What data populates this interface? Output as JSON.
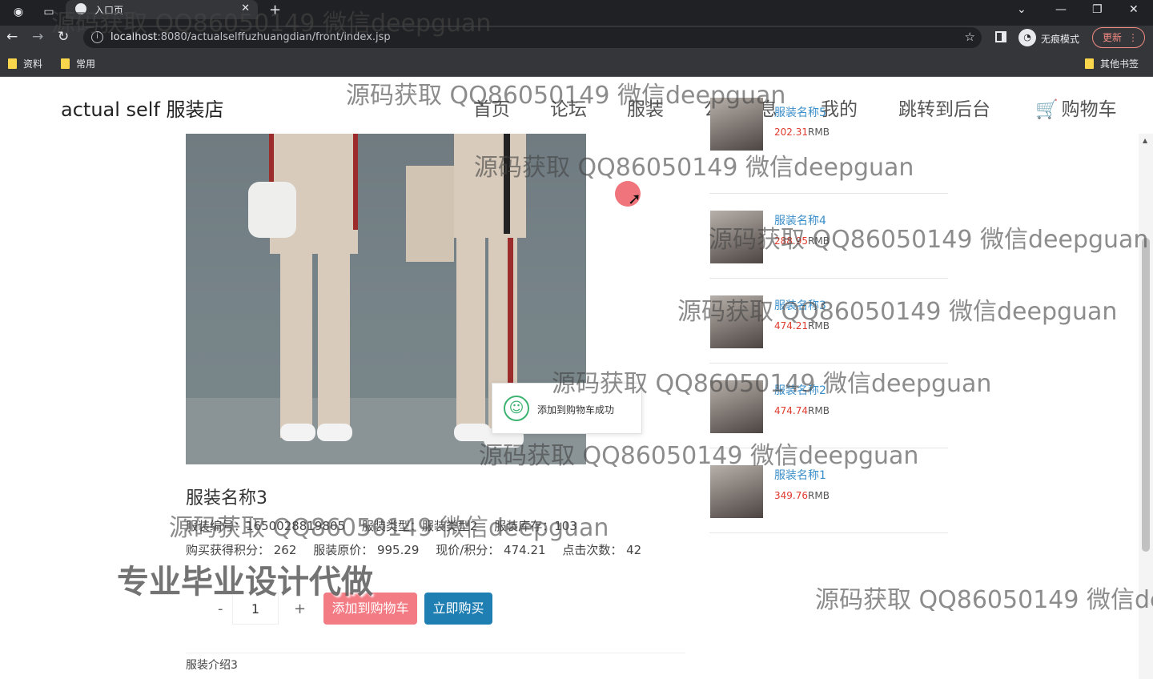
{
  "browser": {
    "tab_title": "入口页",
    "url_host": "localhost",
    "url_rest": ":8080/actualselffuzhuangdian/front/index.jsp",
    "incognito_label": "无痕模式",
    "update_label": "更新",
    "bookmarks": [
      "资料",
      "常用"
    ],
    "other_bookmarks": "其他书签"
  },
  "site": {
    "brand": "actual self 服装店",
    "nav": [
      "首页",
      "论坛",
      "服装",
      "公告信息",
      "我的",
      "跳转到后台",
      "购物车"
    ]
  },
  "product": {
    "name": "服装名称3",
    "meta_row1": [
      "服装编号：1650028819805",
      "服装类型：服装类型2",
      "服装库存：103"
    ],
    "meta_row2": [
      "购买获得积分：  262",
      "服装原价：  995.29",
      "现价/积分：  474.21",
      "点击次数：  42"
    ],
    "quantity": "1",
    "minus": "-",
    "plus": "+",
    "add_to_cart": "添加到购物车",
    "buy_now": "立即购买",
    "intro": "服装介绍3"
  },
  "sidebar": {
    "items": [
      {
        "title": "服装名称5",
        "price": "202.31",
        "unit": "RMB"
      },
      {
        "title": "服装名称4",
        "price": "288.95",
        "unit": "RMB"
      },
      {
        "title": "服装名称3",
        "price": "474.21",
        "unit": "RMB"
      },
      {
        "title": "服装名称2",
        "price": "474.74",
        "unit": "RMB"
      },
      {
        "title": "服装名称1",
        "price": "349.76",
        "unit": "RMB"
      }
    ]
  },
  "toast": {
    "message": "添加到购物车成功"
  },
  "watermarks": {
    "text": "源码获取 QQ86050149 微信deepguan",
    "cut": "源码获取 QQ86050149 微信de",
    "bold": "专业毕业设计代做"
  },
  "colors": {
    "accent_blue": "#1f7fb3",
    "cart_pink": "#f37b84",
    "price_red": "#e03a2e",
    "link_blue": "#3a8ec9"
  }
}
